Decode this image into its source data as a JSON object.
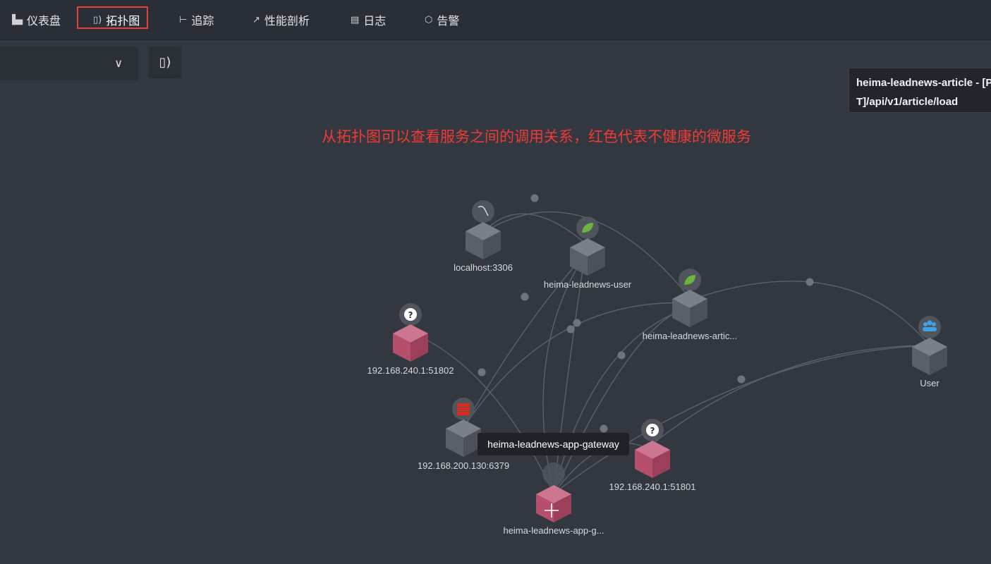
{
  "nav": {
    "items": [
      {
        "label": "仪表盘",
        "icon": "bar-chart-icon"
      },
      {
        "label": "拓扑图",
        "icon": "topology-icon"
      },
      {
        "label": "追踪",
        "icon": "trace-icon"
      },
      {
        "label": "性能剖析",
        "icon": "trend-icon"
      },
      {
        "label": "日志",
        "icon": "log-icon"
      },
      {
        "label": "告警",
        "icon": "alert-icon"
      }
    ],
    "active": "拓扑图"
  },
  "toolbar": {
    "select_value": "",
    "chevron_icon": "chevron-down-icon",
    "topology_button_icon": "topology-icon"
  },
  "tooltip": {
    "line1": "heima-leadnews-article - [P",
    "line2": "T]/api/v1/article/load"
  },
  "annotation": "从拓扑图可以查看服务之间的调用关系，红色代表不健康的微服务",
  "hover_tooltip": "heima-leadnews-app-gateway",
  "nodes": [
    {
      "id": "mysql",
      "label": "localhost:3306",
      "icon": "mysql-icon",
      "healthy": true
    },
    {
      "id": "user",
      "label": "heima-leadnews-user",
      "icon": "spring-leaf-icon",
      "healthy": true
    },
    {
      "id": "article",
      "label": "heima-leadnews-artic...",
      "icon": "spring-leaf-icon",
      "healthy": true
    },
    {
      "id": "ip51802",
      "label": "192.168.240.1:51802",
      "icon": "question-icon",
      "healthy": false
    },
    {
      "id": "redis",
      "label": "192.168.200.130:6379",
      "icon": "redis-icon",
      "healthy": true
    },
    {
      "id": "gateway",
      "label": "heima-leadnews-app-g...",
      "icon": "gateway-icon",
      "healthy": false
    },
    {
      "id": "ip51801",
      "label": "192.168.240.1:51801",
      "icon": "question-icon",
      "healthy": false
    },
    {
      "id": "userclient",
      "label": "User",
      "icon": "users-icon",
      "healthy": true
    }
  ],
  "colors": {
    "healthy_cube": "#5f646d",
    "unhealthy_cube": "#b54f6c",
    "annotation": "#ef3a35",
    "active_outline": "#e5413a",
    "spring_green": "#6db33f",
    "redis_red": "#d82c20",
    "users_blue": "#3fa2e6"
  }
}
